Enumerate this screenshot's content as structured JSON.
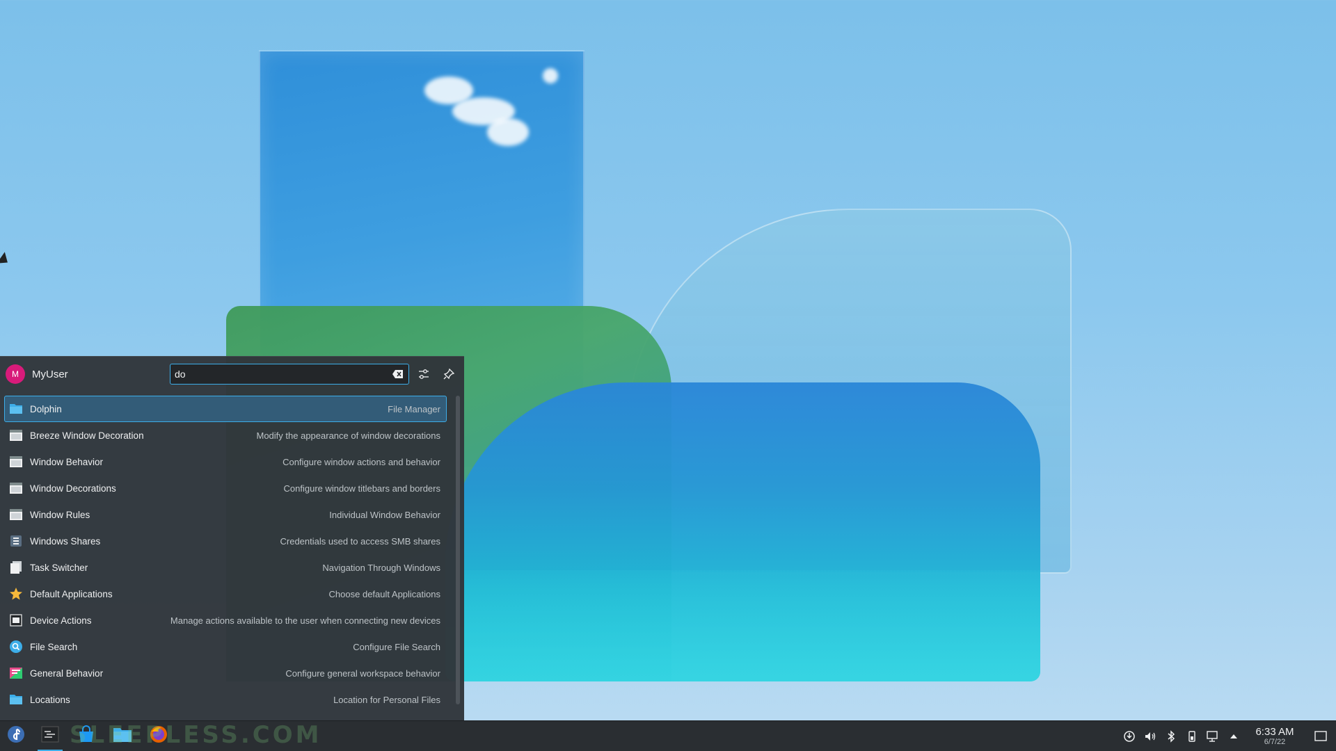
{
  "launcher": {
    "user_initial": "M",
    "user_name": "MyUser",
    "search_value": "do",
    "results": [
      {
        "name": "Dolphin",
        "description": "File Manager",
        "icon": "folder-icon",
        "active": true
      },
      {
        "name": "Breeze Window Decoration",
        "description": "Modify the appearance of window decorations",
        "icon": "window-icon"
      },
      {
        "name": "Window Behavior",
        "description": "Configure window actions and behavior",
        "icon": "window-icon"
      },
      {
        "name": "Window Decorations",
        "description": "Configure window titlebars and borders",
        "icon": "window-icon"
      },
      {
        "name": "Window Rules",
        "description": "Individual Window Behavior",
        "icon": "window-icon"
      },
      {
        "name": "Windows Shares",
        "description": "Credentials used to access SMB shares",
        "icon": "network-share-icon"
      },
      {
        "name": "Task Switcher",
        "description": "Navigation Through Windows",
        "icon": "task-switcher-icon"
      },
      {
        "name": "Default Applications",
        "description": "Choose default Applications",
        "icon": "star-icon"
      },
      {
        "name": "Device Actions",
        "description": "Manage actions available to the user when connecting new devices",
        "icon": "device-icon"
      },
      {
        "name": "File Search",
        "description": "Configure File Search",
        "icon": "search-icon"
      },
      {
        "name": "General Behavior",
        "description": "Configure general workspace behavior",
        "icon": "settings-icon"
      },
      {
        "name": "Locations",
        "description": "Location for Personal Files",
        "icon": "folder-icon"
      }
    ]
  },
  "taskbar": {
    "watermark": "SLEEPLESS.COM",
    "clock_time": "6:33 AM",
    "clock_date": "6/7/22"
  },
  "colors": {
    "accent": "#3daee9",
    "panel": "#31363b",
    "taskbar": "#2a2e32",
    "avatar": "#d81b7a"
  }
}
